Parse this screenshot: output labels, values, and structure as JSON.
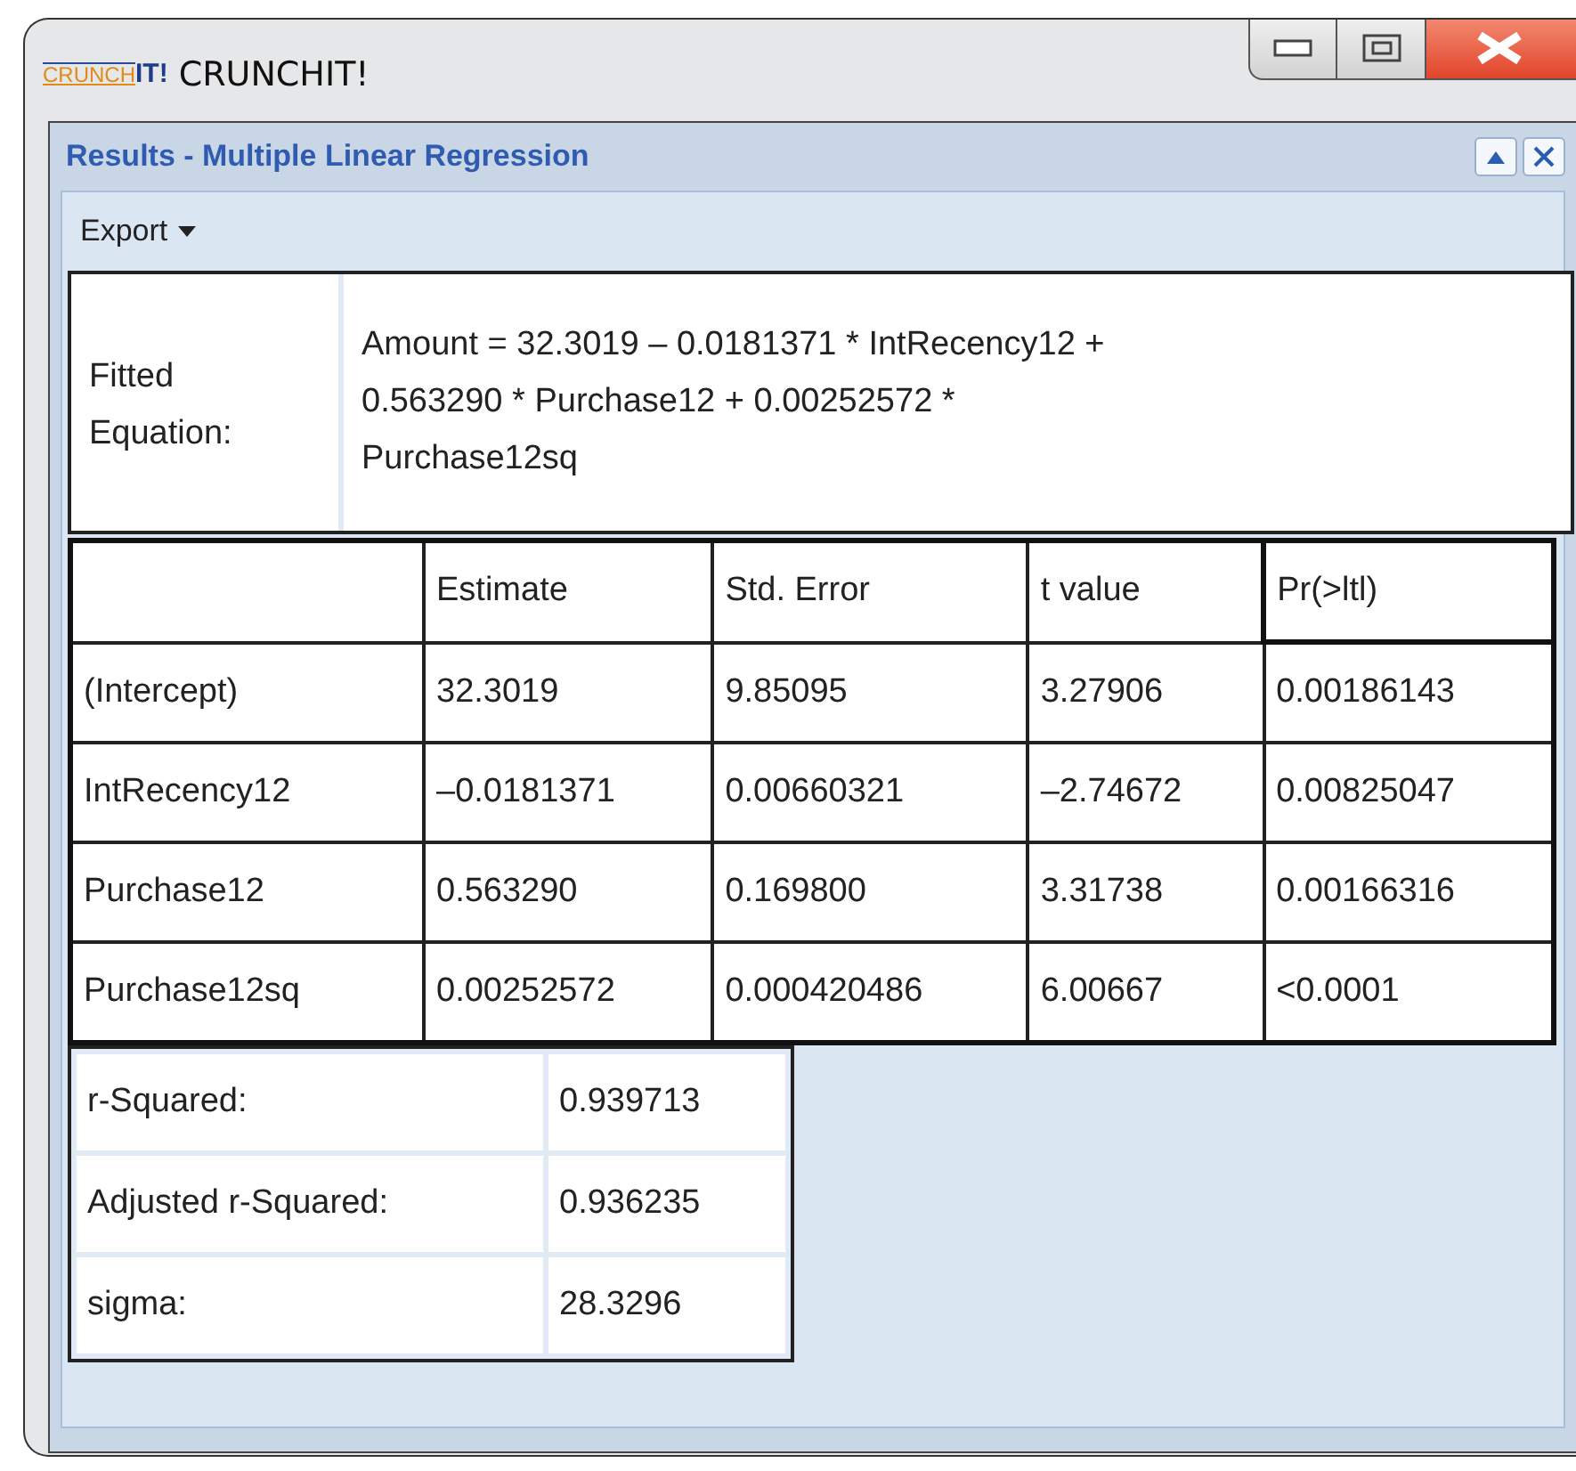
{
  "app": {
    "logo_left": "CRUNCH",
    "logo_right": "IT!",
    "title": "CRUNCHIT!"
  },
  "panel": {
    "title": "Results - Multiple Linear Regression",
    "toolbar": [
      {
        "label": "Export",
        "kind": "dropdown"
      }
    ]
  },
  "equation": {
    "label": "Fitted Equation:",
    "text": "Amount = 32.3019 – 0.0181371 * IntRecency12 + 0.563290 * Purchase12 + 0.00252572 * Purchase12sq"
  },
  "coefficients": {
    "columns": [
      "Estimate",
      "Std. Error",
      "t value",
      "Pr(>ltl)"
    ],
    "rows": [
      {
        "term": "(Intercept)",
        "cells": [
          "32.3019",
          "9.85095",
          "3.27906",
          "0.00186143"
        ]
      },
      {
        "term": "IntRecency12",
        "cells": [
          "–0.0181371",
          "0.00660321",
          "–2.74672",
          "0.00825047"
        ]
      },
      {
        "term": "Purchase12",
        "cells": [
          "0.563290",
          "0.169800",
          "3.31738",
          "0.00166316"
        ]
      },
      {
        "term": "Purchase12sq",
        "cells": [
          "0.00252572",
          "0.000420486",
          "6.00667",
          "<0.0001"
        ]
      }
    ]
  },
  "statistics": [
    {
      "label": "r-Squared:",
      "value": "0.939713"
    },
    {
      "label": "Adjusted r-Squared:",
      "value": "0.936235"
    },
    {
      "label": "sigma:",
      "value": "28.3296"
    }
  ]
}
